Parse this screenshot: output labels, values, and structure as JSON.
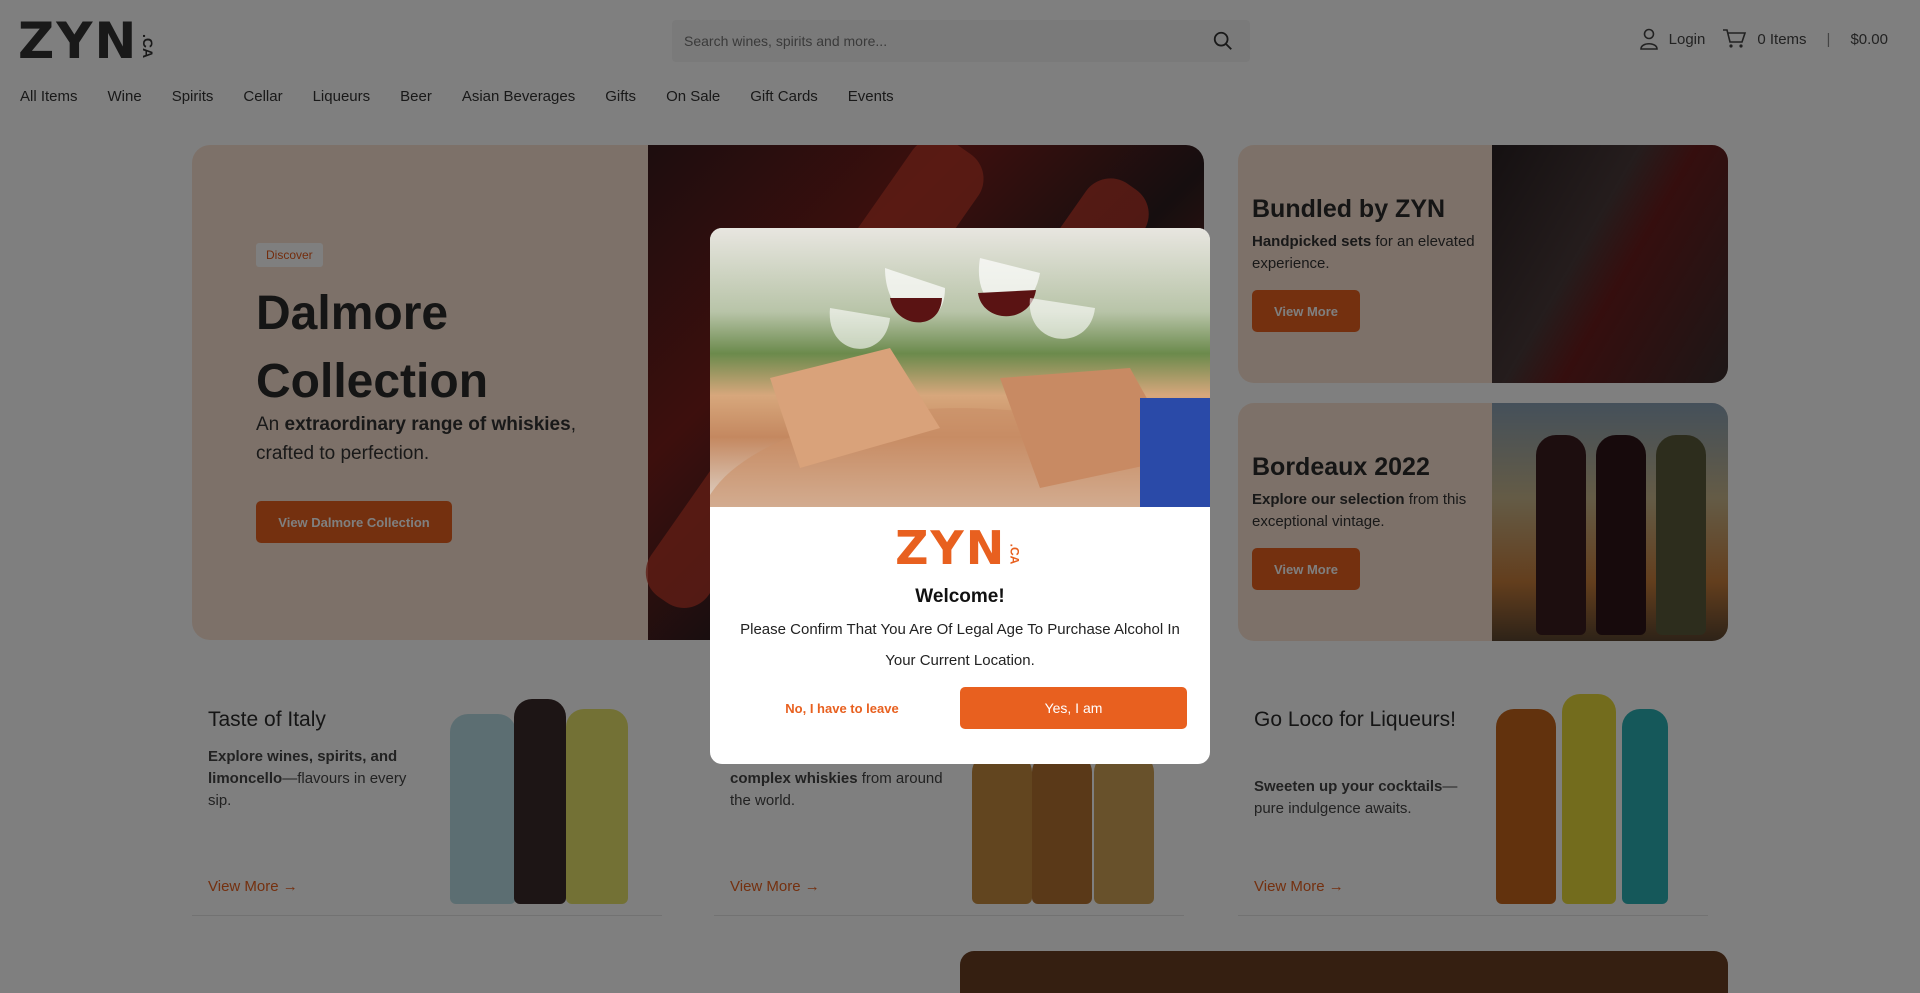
{
  "header": {
    "logo_text": "ZYN",
    "logo_suffix": ".CA",
    "search_placeholder": "Search wines, spirits and more...",
    "login_label": "Login",
    "cart_items": "0 Items",
    "cart_separator": "|",
    "cart_total": "$0.00"
  },
  "nav": {
    "items": [
      "All Items",
      "Wine",
      "Spirits",
      "Cellar",
      "Liqueurs",
      "Beer",
      "Asian Beverages",
      "Gifts",
      "On Sale",
      "Gift Cards",
      "Events"
    ]
  },
  "hero": {
    "badge": "Discover",
    "title": "Dalmore Collection",
    "subtitle_pre": "An ",
    "subtitle_bold": "extraordinary range of whiskies",
    "subtitle_post": ", crafted to perfection.",
    "button": "View Dalmore Collection"
  },
  "promos": [
    {
      "title": "Bundled by ZYN",
      "bold": "Handpicked sets",
      "rest": " for an elevated experience.",
      "button": "View More"
    },
    {
      "title": "Bordeaux 2022",
      "bold": "Explore our selection",
      "rest": " from this exceptional vintage.",
      "button": "View More"
    }
  ],
  "cards": [
    {
      "title": "Taste of Italy",
      "bold": "Explore wines, spirits, and limoncello",
      "rest": "—flavours in every sip.",
      "link": "View More"
    },
    {
      "title": "",
      "bold": "complex whiskies",
      "rest": " from around the world.",
      "link": "View More"
    },
    {
      "title": "Go Loco for Liqueurs!",
      "bold": "Sweeten up your cocktails",
      "rest": "—pure indulgence awaits.",
      "link": "View More"
    }
  ],
  "modal": {
    "logo_text": "ZYN",
    "logo_suffix": ".CA",
    "title": "Welcome!",
    "message": "Please Confirm That You Are Of Legal Age To Purchase Alcohol In Your Current Location.",
    "leave_label": "No, I have to leave",
    "confirm_label": "Yes, I am"
  },
  "colors": {
    "accent": "#e8601f",
    "promo_bg": "#fbe3d2",
    "overlay": "rgba(0,0,0,0.5)"
  },
  "icons": [
    "search-icon",
    "user-icon",
    "cart-icon",
    "arrow-right-icon"
  ]
}
